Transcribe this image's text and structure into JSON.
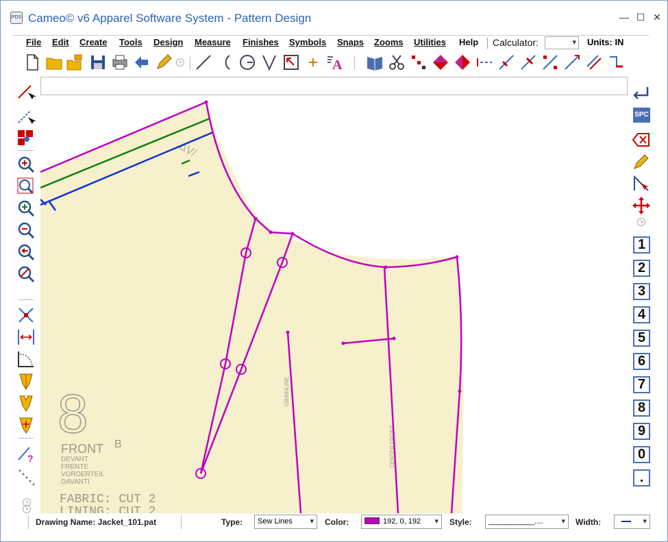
{
  "window": {
    "title": "Cameo© v6 Apparel Software System - Pattern Design",
    "icon_label": "PDS",
    "controls": [
      "minimize-icon",
      "maximize-icon",
      "close-icon"
    ]
  },
  "menubar": {
    "items": [
      "File",
      "Edit",
      "Create",
      "Tools",
      "Design",
      "Measure",
      "Finishes",
      "Symbols",
      "Snaps",
      "Zooms",
      "Utilities",
      "Help"
    ],
    "calculator_label": "Calculator:",
    "calculator_value": "",
    "units": "Units: IN"
  },
  "toolbar": {
    "icons": [
      "new-file-icon",
      "open-folder-icon",
      "open-multiple-icon",
      "save-icon",
      "print-icon",
      "undo-icon",
      "pencil-icon",
      "more-icon",
      "line-icon",
      "arc-icon",
      "circle-icon",
      "dart-icon",
      "rectangle-icon",
      "point-icon",
      "text-icon",
      "book-icon",
      "scissors-icon",
      "points-icon",
      "mirror-horizontal-icon",
      "mirror-vertical-icon",
      "dash-line-icon",
      "intersect-icon",
      "cross-icon",
      "split-icon",
      "extend-icon",
      "parallel-icon",
      "move-corner-icon"
    ]
  },
  "command_line": {
    "value": ""
  },
  "left_toolbar": {
    "icons": [
      "select-point-icon",
      "select-line-icon",
      "select-piece-icon",
      "zoom-in-icon",
      "zoom-window-icon",
      "zoom-plus-icon",
      "zoom-minus-icon",
      "zoom-previous-icon",
      "zoom-off-icon",
      "move-points-icon",
      "measure-distance-icon",
      "curve-measure-icon",
      "piece-yellow-icon",
      "piece-notch-icon",
      "piece-grade-icon",
      "help-line-icon",
      "dots-icon"
    ]
  },
  "right_toolbar": {
    "icons": [
      "enter-icon",
      "space-icon",
      "delete-icon",
      "pencil-edit-icon",
      "snap-icon",
      "move-cross-icon"
    ],
    "spc_label": "SPC",
    "numbers": [
      "1",
      "2",
      "3",
      "4",
      "5",
      "6",
      "7",
      "8",
      "9",
      "0",
      "."
    ]
  },
  "pattern": {
    "labels": {
      "size": "8",
      "piece": "FRONT",
      "piece_code": "B",
      "translations": [
        "DEVANT",
        "FRENTE",
        "VORDERTEIL",
        "DAVANTI"
      ],
      "fabric": "FABRIC: CUT 2",
      "lining": "LINING: CUT 2",
      "grainline": "GRAINLINE",
      "center_front": "CENTER FRONT"
    },
    "colors": {
      "paper": "#f7f0cc",
      "sew_line": "#c000c0",
      "green_line": "#108010",
      "blue_line": "#1030d0"
    }
  },
  "statusbar": {
    "drawing_name": "Drawing Name: Jacket_101.pat",
    "type_label": "Type:",
    "type_value": "Sew Lines",
    "color_label": "Color:",
    "color_value": "192, 0, 192",
    "style_label": "Style:",
    "style_value": "___________....",
    "width_label": "Width:"
  }
}
